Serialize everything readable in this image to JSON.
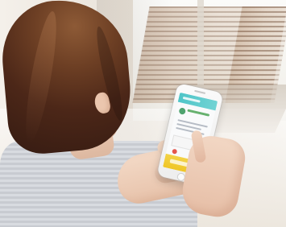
{
  "scene": {
    "subject": "woman-using-smartphone",
    "colors": {
      "hair": "#4c2718",
      "skin": "#f2d7c4",
      "shirt": "#d8dbe0",
      "phone_accent": "#4ec5c8",
      "phone_footer": "#efc526"
    }
  }
}
